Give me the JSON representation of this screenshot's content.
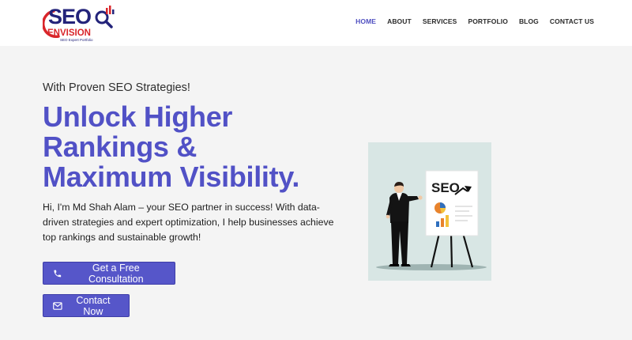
{
  "brand": {
    "logo_text_top": "SEO",
    "logo_text_mid": "ENVISION",
    "logo_text_small": "SEO Expert Portfolio",
    "accent_color": "#5151c6",
    "logo_red": "#d9252a",
    "logo_blue": "#23237a"
  },
  "nav": {
    "items": [
      {
        "label": "HOME",
        "active": true
      },
      {
        "label": "ABOUT"
      },
      {
        "label": "SERVICES"
      },
      {
        "label": "PORTFOLIO"
      },
      {
        "label": "BLOG"
      },
      {
        "label": "CONTACT US"
      }
    ]
  },
  "hero": {
    "pretitle": "With Proven SEO Strategies!",
    "headline_line1": "Unlock Higher",
    "headline_line2": "Rankings &",
    "headline_line3": "Maximum Visibility.",
    "intro": "Hi, I'm Md Shah Alam – your SEO partner in success! With data-driven strategies and expert optimization, I help businesses achieve top rankings and sustainable growth!"
  },
  "buttons": {
    "consult_label": "Get a Free Consultation",
    "consult_icon": "phone-icon",
    "contact_label": "Contact Now",
    "contact_icon": "envelope-icon"
  },
  "illustration": {
    "board_text": "SEO"
  }
}
